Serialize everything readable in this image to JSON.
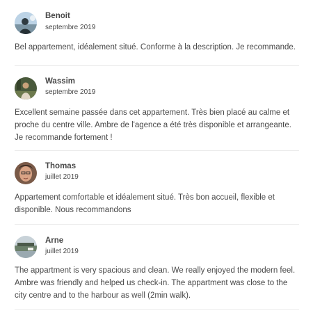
{
  "reviews": [
    {
      "reviewer": "Benoit",
      "date": "septembre 2019",
      "text": "Bel appartement, idéalement situé. Conforme à la description. Je recommande.",
      "avatar": "avatar-photo"
    },
    {
      "reviewer": "Wassim",
      "date": "septembre 2019",
      "text": "Excellent semaine passée dans cet appartement. Très bien placé au calme et proche du centre ville. Ambre de l'agence a été très disponible et arrangeante. Je recommande fortement !",
      "avatar": "avatar-photo"
    },
    {
      "reviewer": "Thomas",
      "date": "juillet 2019",
      "text": "Appartement comfortable et idéalement situé. Très bon accueil, flexible et disponible. Nous recommandons",
      "avatar": "avatar-photo"
    },
    {
      "reviewer": "Arne",
      "date": "juillet 2019",
      "text": "The appartment is very spacious and clean. We really enjoyed the modern feel. Ambre was friendly and helped us check-in. The appartment was close to the city centre and to the harbour as well (2min walk).",
      "avatar": "avatar-photo"
    }
  ],
  "colors": {
    "text": "#484848",
    "divider": "#ebebeb"
  }
}
